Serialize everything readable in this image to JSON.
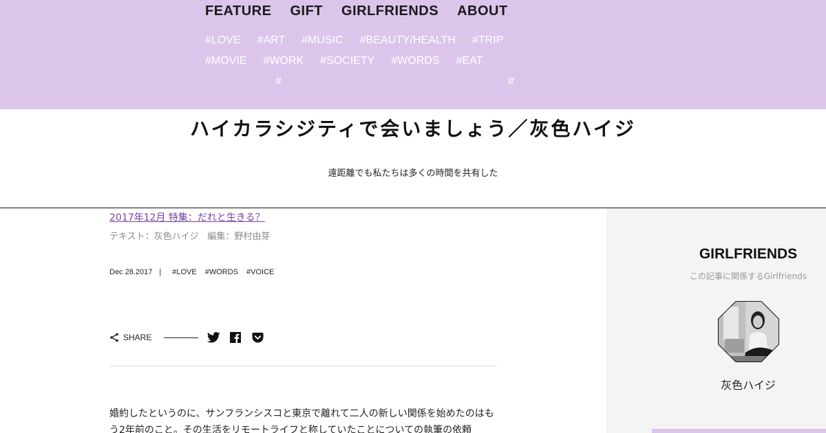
{
  "header": {
    "main_nav": [
      "FEATURE",
      "GIFT",
      "GIRLFRIENDS",
      "ABOUT"
    ],
    "tags_row1": [
      "#LOVE",
      "#ART",
      "#MUSIC",
      "#BEAUTY/HEALTH",
      "#TRIP"
    ],
    "tags_row2": [
      "#MOVIE",
      "#WORK",
      "#SOCIETY",
      "#WORDS",
      "#EAT"
    ],
    "stray_hash": "#"
  },
  "site": {
    "title": "ハイカラシジティで会いましょう／灰色ハイジ",
    "subtitle": "遠距離でも私たちは多くの時間を共有した"
  },
  "article": {
    "issue": "2017年12月 特集：だれと生きる？",
    "credits": "テキスト：灰色ハイジ　編集：野村由芽",
    "date": "Dec 28.2017",
    "separator": "|",
    "tags": [
      "#LOVE",
      "#WORDS",
      "#VOICE"
    ],
    "share_label": "SHARE",
    "body": "婚約したというのに、サンフランシスコと東京で離れて二人の新しい関係を始めたのはもう2年前のこと。その生活をリモートライフと称していたことについての執筆の依頼"
  },
  "sidebar": {
    "title": "GIRLFRIENDS",
    "subtitle": "この記事に関係するGirlfriends",
    "person_name": "灰色ハイジ"
  },
  "colors": {
    "header_bg": "#dcc5ea",
    "accent": "#7a3fa0",
    "sidebar_bg": "#f4f4f4"
  }
}
